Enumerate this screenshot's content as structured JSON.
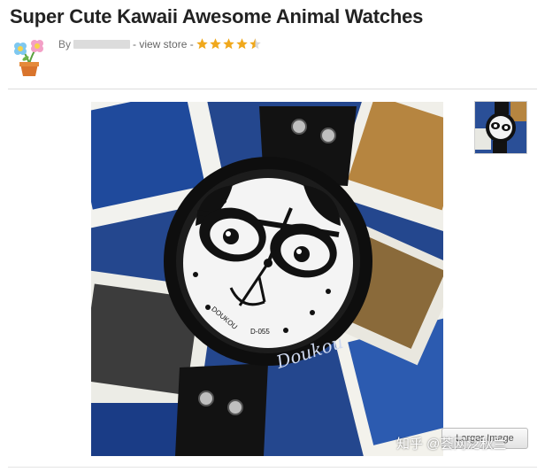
{
  "listing": {
    "title": "Super Cute Kawaii Awesome Animal Watches",
    "by_label": "By",
    "view_store": "- view store -",
    "rating": 4.5,
    "rating_max": 5
  },
  "gallery": {
    "zoom_label": "Larger Image"
  },
  "watch": {
    "brand_face": "DOUKOU",
    "model": "D-055",
    "strap_script": "Doukou"
  },
  "watermark": "知乎 @荟网泛秋兰",
  "colors": {
    "star": "#f0a81c",
    "strap": "#151515",
    "dial": "#f4f4f4",
    "background_blue": "#1d3f8a"
  },
  "icons": {
    "shop_logo": "flower-pot-icon",
    "rating": "star-icon"
  }
}
